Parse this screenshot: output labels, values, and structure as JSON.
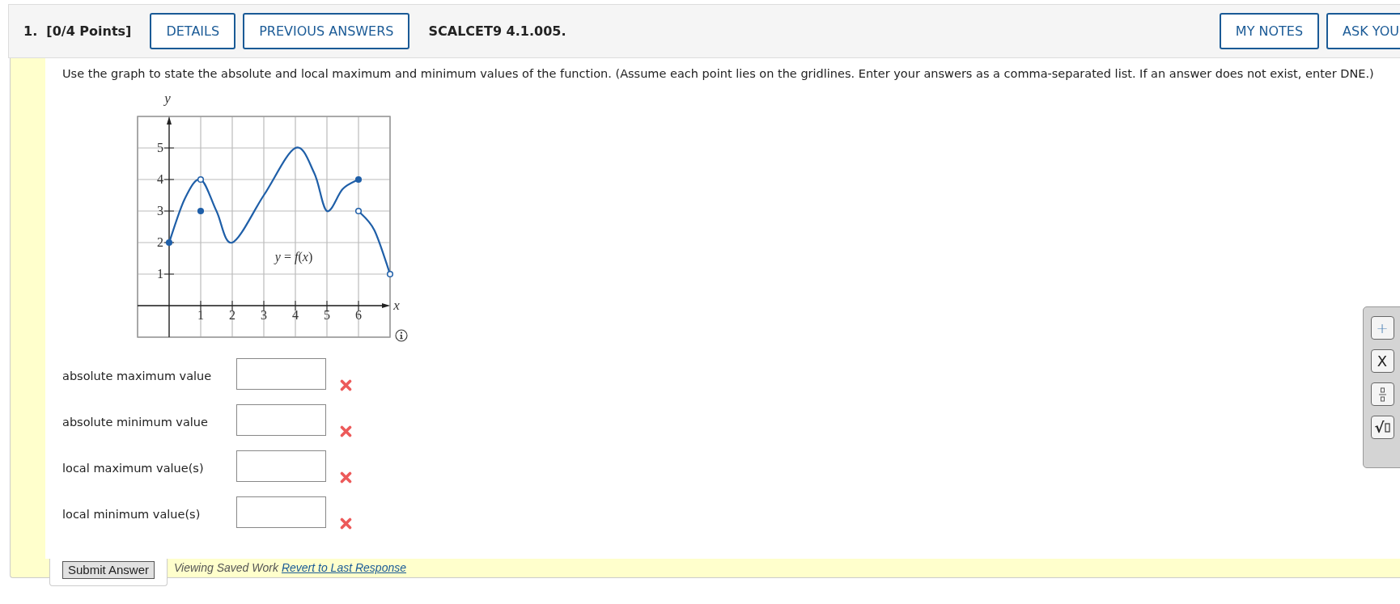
{
  "header": {
    "number": "1.",
    "points": "[0/4 Points]",
    "buttons": [
      "DETAILS",
      "PREVIOUS ANSWERS"
    ],
    "code": "SCALCET9 4.1.005.",
    "right_buttons": [
      "MY NOTES",
      "ASK YOU"
    ]
  },
  "prompt": "Use the graph to state the absolute and local maximum and minimum values of the function. (Assume each point lies on the gridlines. Enter your answers as a comma-separated list. If an answer does not exist, enter DNE.)",
  "graph": {
    "chart_data": {
      "type": "line",
      "xlabel": "x",
      "ylabel": "y",
      "grid": true,
      "x": [
        0,
        0.5,
        1,
        1.5,
        2,
        3,
        4,
        4.6,
        5,
        5.5,
        6,
        6.5,
        7
      ],
      "series": [
        {
          "name": "*y* = *f*(*x*)",
          "color": "#1f5fa8",
          "values": [
            2,
            3.4,
            4,
            3,
            2,
            3.5,
            5,
            4.2,
            3,
            3.7,
            4,
            null,
            null
          ]
        },
        {
          "color": "#1f5fa8",
          "values": [
            null,
            null,
            null,
            null,
            null,
            null,
            null,
            null,
            null,
            null,
            3,
            2.4,
            1
          ]
        },
        {
          "type": "scatter",
          "color": "#1f5fa8",
          "marker": "circle",
          "values": [
            2,
            null,
            3,
            null,
            null,
            null,
            null,
            null,
            null,
            null,
            4,
            null,
            null
          ]
        },
        {
          "type": "scatter",
          "color": "#ffffff",
          "marker": "circle",
          "values": [
            null,
            null,
            4,
            null,
            null,
            null,
            null,
            null,
            null,
            null,
            3,
            null,
            1
          ]
        }
      ],
      "xlim": [
        -1,
        7
      ],
      "ylim": [
        -1,
        6
      ],
      "xticks": [
        1,
        2,
        3,
        4,
        5,
        6
      ],
      "yticks": [
        1,
        2,
        3,
        4,
        5
      ]
    }
  },
  "answers": [
    {
      "label": "absolute maximum value",
      "correct": false
    },
    {
      "label": "absolute minimum value",
      "correct": false
    },
    {
      "label": "local maximum value(s)",
      "correct": false
    },
    {
      "label": "local minimum value(s)",
      "correct": false
    }
  ],
  "palette": [
    {
      "kind": "text",
      "label": "+"
    },
    {
      "kind": "text",
      "label": "X"
    },
    {
      "kind": "fraction"
    },
    {
      "kind": "sqrt",
      "label": "√"
    }
  ],
  "footer": {
    "submit": "Submit Answer",
    "status": "Viewing Saved Work",
    "link": "Revert to Last Response"
  }
}
